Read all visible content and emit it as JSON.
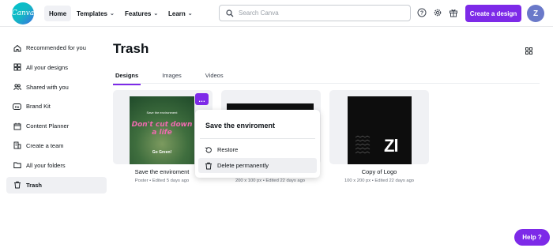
{
  "brand": {
    "logo_text": "Canva",
    "accent": "#7d2ae8",
    "teal": "#00c4cc"
  },
  "nav": {
    "home": "Home",
    "templates": "Templates",
    "features": "Features",
    "learn": "Learn"
  },
  "search": {
    "placeholder": "Search Canva"
  },
  "header": {
    "create_label": "Create a design",
    "avatar_initial": "Z"
  },
  "sidebar": {
    "items": [
      {
        "label": "Recommended for you",
        "icon": "home-icon"
      },
      {
        "label": "All your designs",
        "icon": "grid-icon"
      },
      {
        "label": "Shared with you",
        "icon": "people-icon"
      },
      {
        "label": "Brand Kit",
        "icon": "brand-kit-icon"
      },
      {
        "label": "Content Planner",
        "icon": "calendar-icon"
      },
      {
        "label": "Create a team",
        "icon": "building-icon"
      },
      {
        "label": "All your folders",
        "icon": "folder-icon"
      },
      {
        "label": "Trash",
        "icon": "trash-icon",
        "active": true
      }
    ]
  },
  "main": {
    "title": "Trash",
    "tabs": [
      {
        "label": "Designs",
        "active": true
      },
      {
        "label": "Images"
      },
      {
        "label": "Videos"
      }
    ],
    "cards": [
      {
        "name": "Save the enviroment",
        "meta": "Poster • Edited 5 days ago",
        "thumb_small": "Save the environment",
        "thumb_title": "Don't cut down a life",
        "thumb_sub": "Go Green!"
      },
      {
        "name": "",
        "meta": "200 x 100 px • Edited 22 days ago"
      },
      {
        "name": "Copy of Logo",
        "meta": "100 x 200 px • Edited 22 days ago",
        "thumb_text": "Zl"
      }
    ]
  },
  "popup": {
    "title": "Save the enviroment",
    "items": [
      {
        "label": "Restore",
        "icon": "restore-icon"
      },
      {
        "label": "Delete permanently",
        "icon": "trash-icon"
      }
    ]
  },
  "help": {
    "label": "Help ?"
  }
}
